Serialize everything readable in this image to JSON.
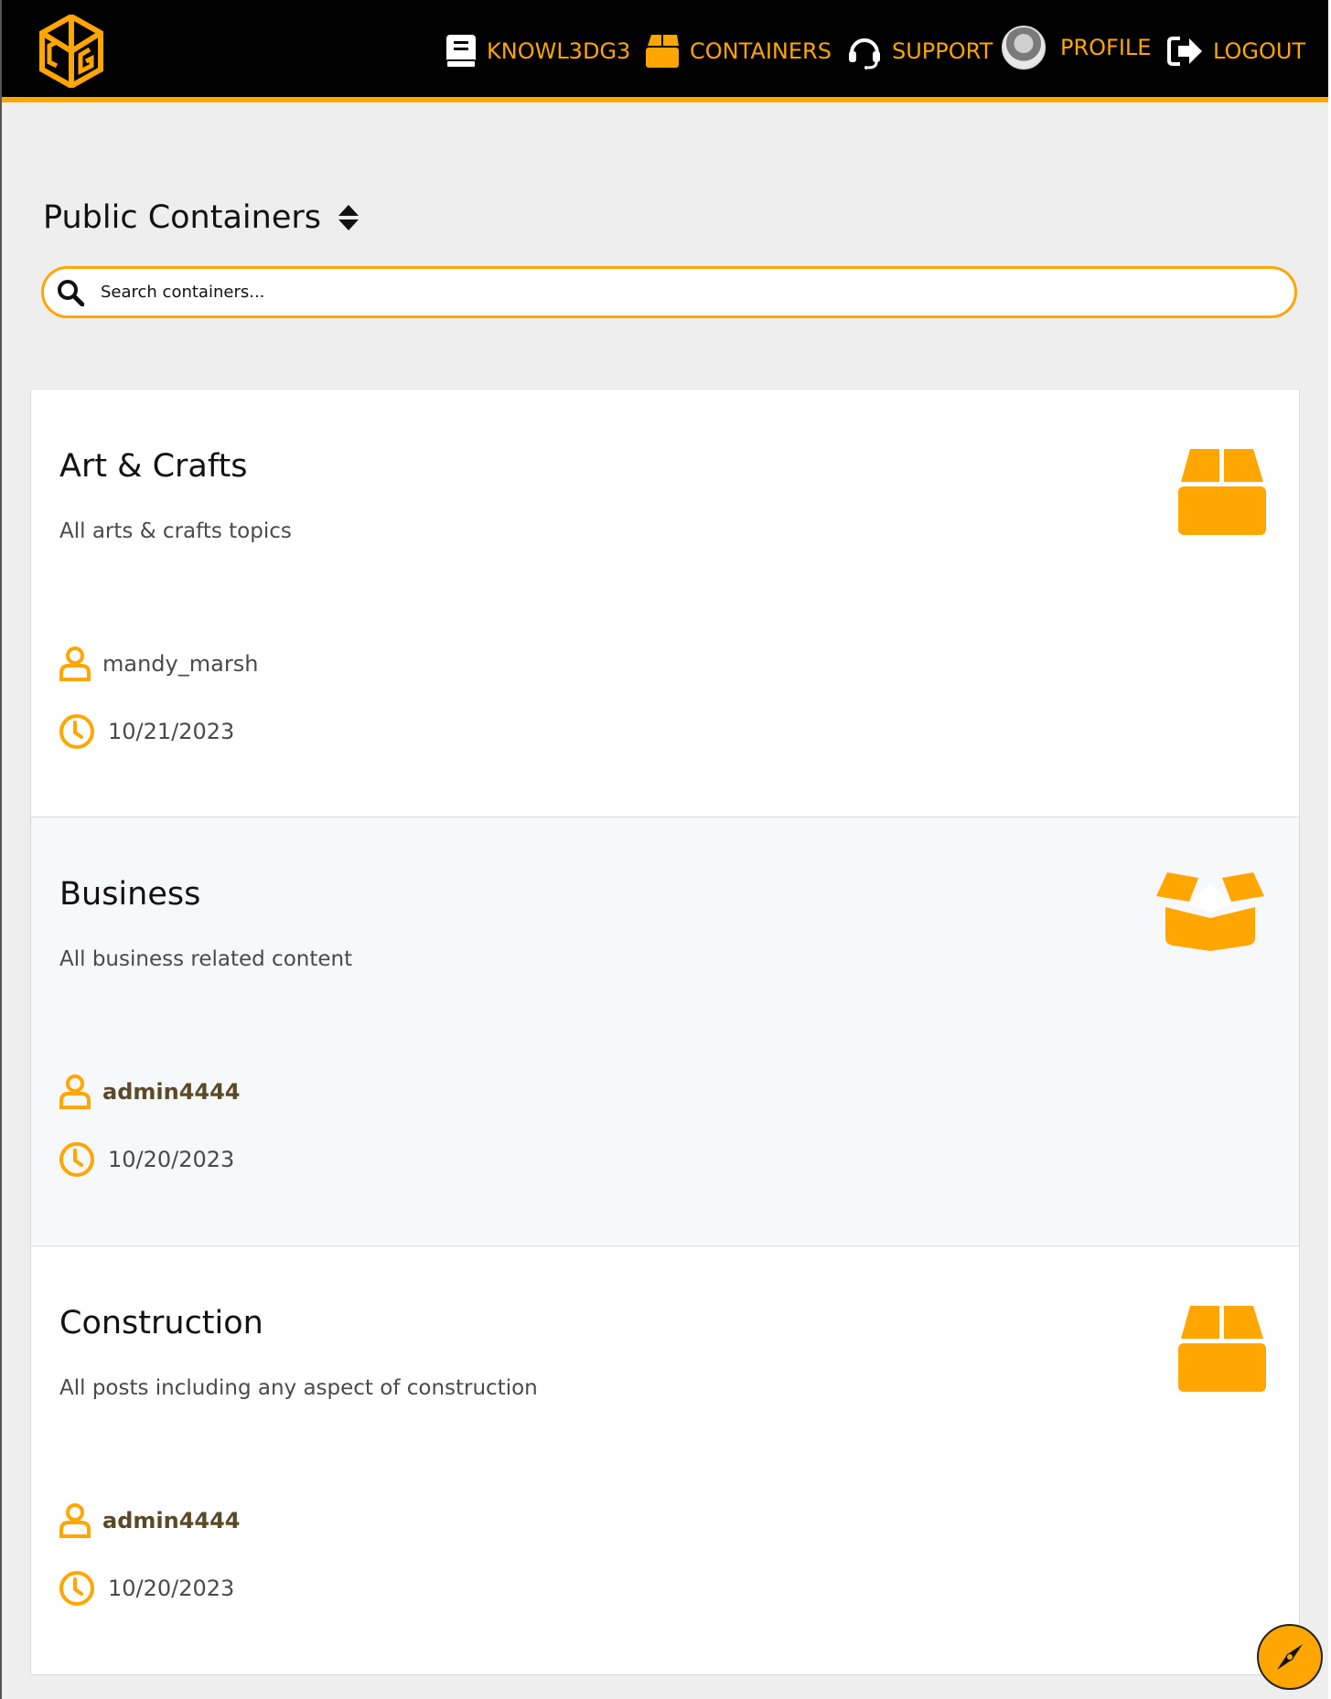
{
  "header": {
    "logo_name": "cgg-logo",
    "nav": [
      {
        "label": "KNOWL3DG3",
        "icon": "book-icon"
      },
      {
        "label": "CONTAINERS",
        "icon": "box-icon"
      },
      {
        "label": "SUPPORT",
        "icon": "headset-icon"
      },
      {
        "label": "PROFILE",
        "icon": "avatar"
      },
      {
        "label": "LOGOUT",
        "icon": "logout-icon"
      }
    ]
  },
  "page": {
    "title": "Public Containers",
    "search_placeholder": "Search containers..."
  },
  "containers": [
    {
      "title": "Art & Crafts",
      "description": "All arts & crafts topics",
      "owner": "mandy_marsh",
      "date": "10/21/2023",
      "icon": "closed-box-icon"
    },
    {
      "title": "Business",
      "description": "All business related content",
      "owner": "admin4444",
      "date": "10/20/2023",
      "icon": "open-box-icon"
    },
    {
      "title": "Construction",
      "description": "All posts including any aspect of construction",
      "owner": "admin4444",
      "date": "10/20/2023",
      "icon": "closed-box-icon"
    }
  ],
  "colors": {
    "accent": "#ffa600",
    "header_bg": "#000000",
    "page_bg": "#efeeee"
  }
}
